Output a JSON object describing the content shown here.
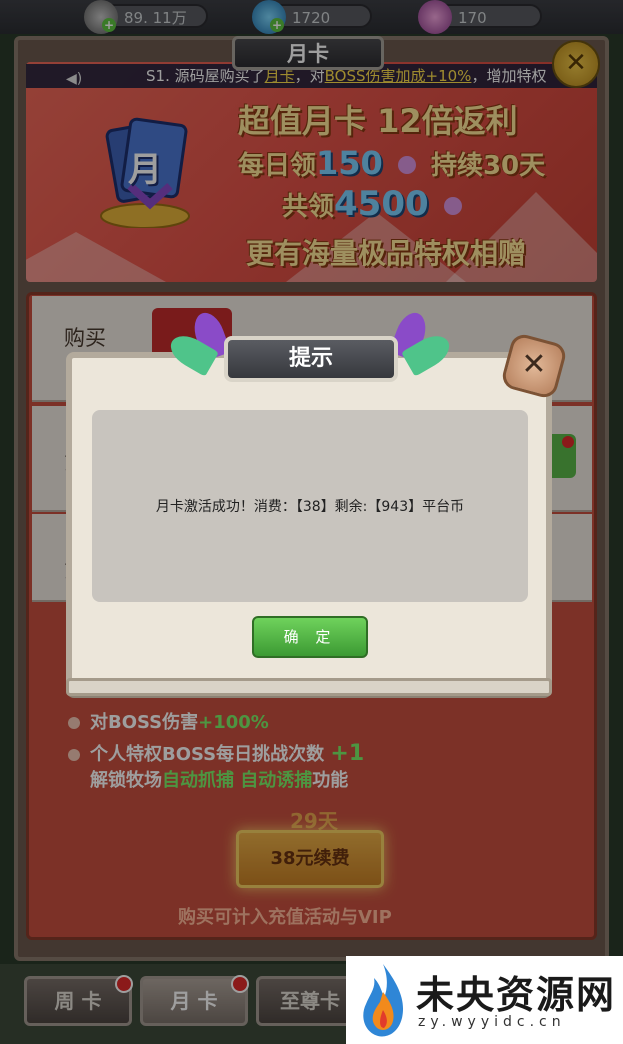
{
  "resources": [
    {
      "icon": "energy-icon",
      "value": "89. 11万"
    },
    {
      "icon": "gem-icon",
      "value": "1720"
    },
    {
      "icon": "shell-icon",
      "value": "170"
    }
  ],
  "header": {
    "title": "月卡"
  },
  "marquee": {
    "prefix": "S1. 源码屋购买了",
    "item": "月卡",
    "mid": "，对",
    "buff": "BOSS伤害加成+10%",
    "suffix": "，增加特权"
  },
  "promo": {
    "line1": "超值月卡  12倍返利",
    "daily_prefix": "每日领",
    "daily_amount": "150",
    "daily_suffix": "持续30天",
    "total_prefix": "共领",
    "total_amount": "4500",
    "line4": "更有海量极品特权相赠",
    "card_char": "月"
  },
  "rows": [
    {
      "label": "购买"
    },
    {
      "label": "第"
    },
    {
      "label": "第"
    }
  ],
  "benefits": {
    "b1_text": "对BOSS伤害",
    "b1_value": "+100%",
    "b2_text": "个人特权BOSS每日挑战次数",
    "b2_value": "+1",
    "b3_prefix": "解锁牧场",
    "b3_h1": "自动抓捕",
    "b3_h2": "自动诱捕",
    "b3_suffix": "功能"
  },
  "days_left": "29天",
  "renew_button": "38元续费",
  "vip_note": "购买可计入充值活动与VIP",
  "bottom_tabs": [
    {
      "label": "周 卡",
      "badge": true
    },
    {
      "label": "月 卡",
      "badge": true,
      "active": true
    },
    {
      "label": "至尊卡",
      "badge": false
    }
  ],
  "dialog": {
    "title": "提示",
    "message": "月卡激活成功！消费：【38】剩余:【943】平台币",
    "ok_label": "确 定"
  },
  "watermark": {
    "title": "未央资源网",
    "url": "zy.wyyidc.cn"
  },
  "colors": {
    "dialog_ok": "#4caf3e",
    "panel_red": "#c8503f",
    "promo_gold": "#ffe79a",
    "highlight_green": "#7df06a"
  }
}
